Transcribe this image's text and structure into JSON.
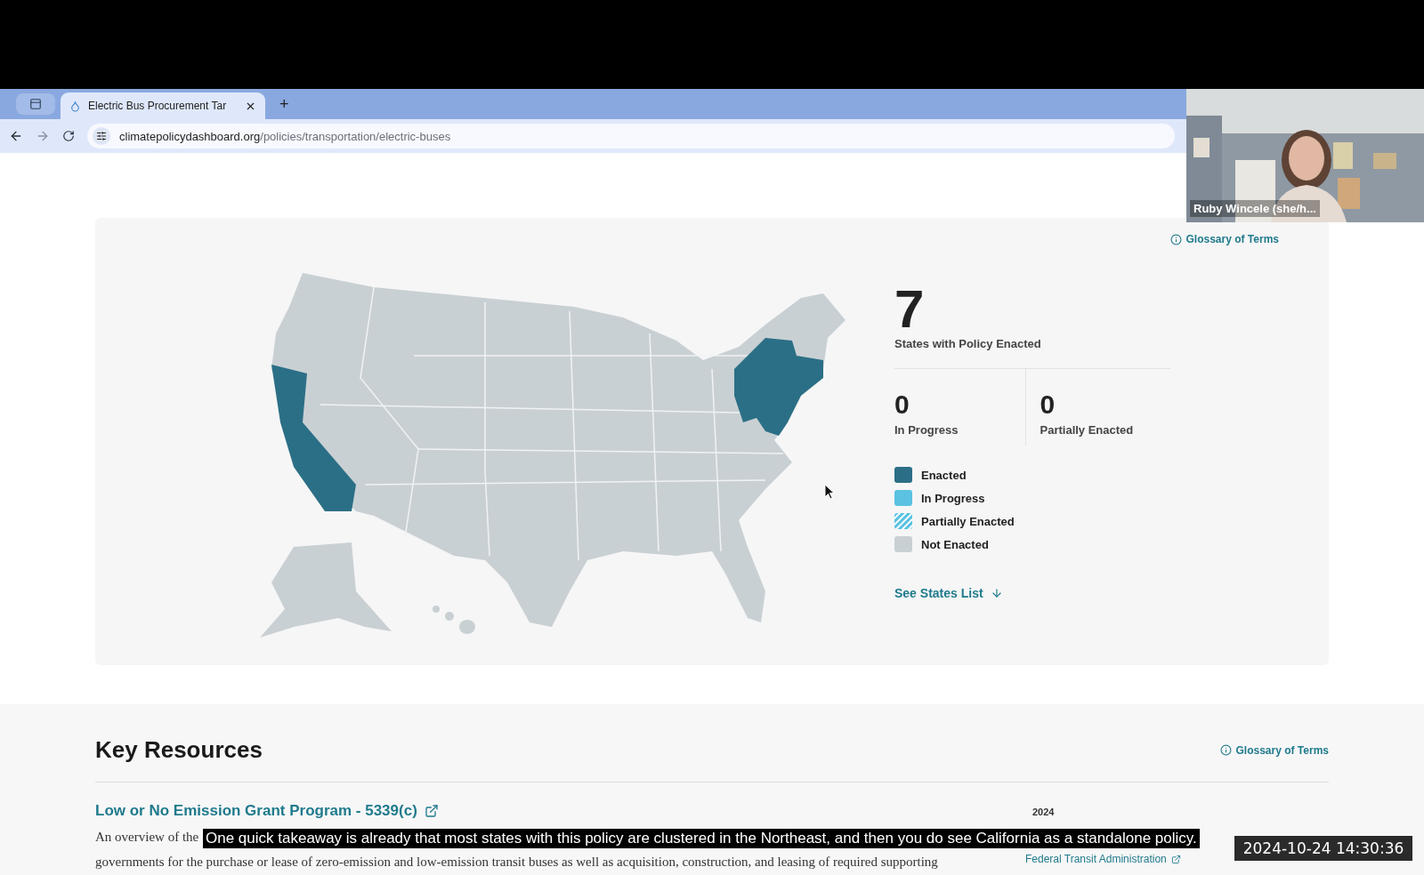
{
  "browser": {
    "tabs": [
      {
        "title": "Electric Bus Procurement Tar",
        "selected": true
      }
    ],
    "new_tab": "+",
    "url_domain": "climatepolicydashboard.org",
    "url_path": "/policies/transportation/electric-buses"
  },
  "video_call": {
    "participant": "Ruby Wincele (she/h..."
  },
  "map_card": {
    "glossary": "Glossary of Terms",
    "headline": {
      "value": "7",
      "label": "States with Policy Enacted"
    },
    "counts": [
      {
        "value": "0",
        "label": "In Progress"
      },
      {
        "value": "0",
        "label": "Partially Enacted"
      }
    ],
    "legend": [
      {
        "label": "Enacted",
        "kind": "solid",
        "color": "#2b6f86"
      },
      {
        "label": "In Progress",
        "kind": "solid",
        "color": "#5bc2e2"
      },
      {
        "label": "Partially Enacted",
        "kind": "striped",
        "color": "#5bc2e2"
      },
      {
        "label": "Not Enacted",
        "kind": "solid",
        "color": "#c9d0d4"
      }
    ],
    "states_link": "See States List"
  },
  "key_resources": {
    "title": "Key Resources",
    "glossary": "Glossary of Terms",
    "items": [
      {
        "title": "Low or No Emission Grant Program - 5339(c)",
        "year": "2024",
        "source": "Federal Transit Administration",
        "description_lines": [
          "An overview of the",
          "governments for the purchase or lease of zero-emission and low-emission transit buses as well as acquisition, construction, and leasing of required supporting"
        ]
      }
    ]
  },
  "caption": "One quick takeaway is already that most states with this policy are clustered in the Northeast, and then you do see California as a standalone policy.",
  "timestamp": "2024-10-24 14:30:36"
}
